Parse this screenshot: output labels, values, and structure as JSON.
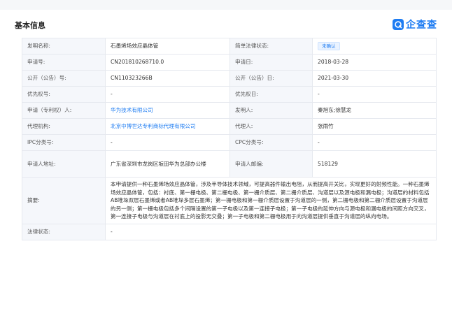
{
  "header": {
    "title": "基本信息",
    "logo_text": "企查查"
  },
  "rows": [
    {
      "l1": "发明名称:",
      "v1": "石墨烯场效应晶体管",
      "l2": "简单法律状态:",
      "v2": "未确认"
    },
    {
      "l1": "申请号:",
      "v1": "CN201810268710.0",
      "l2": "申请日:",
      "v2": "2018-03-28"
    },
    {
      "l1": "公开（公告）号:",
      "v1": "CN110323266B",
      "l2": "公开（公告）日:",
      "v2": "2021-03-30"
    },
    {
      "l1": "优先权号:",
      "v1": "-",
      "l2": "优先权日:",
      "v2": "-"
    },
    {
      "l1": "申请（专利权）人:",
      "v1": "华为技术有限公司",
      "l2": "发明人:",
      "v2": "秦旭东;徐慧龙"
    },
    {
      "l1": "代理机构:",
      "v1": "北京中博世达专利商标代理有限公司",
      "l2": "代理人:",
      "v2": "张雨竹"
    },
    {
      "l1": "IPC分类号:",
      "v1": "-",
      "l2": "CPC分类号:",
      "v2": "-"
    },
    {
      "l1": "申请人地址:",
      "v1": "广东省深圳市龙岗区坂田华为总部办公楼",
      "l2": "申请人邮编:",
      "v2": "518129"
    }
  ],
  "abstract": {
    "label": "摘要:",
    "text": "本申请提供一种石墨烯场效应晶体管，涉及半导体技术领域，可提高器件输出电阻，从而提高开关比，实现更好的射频性能。一种石墨烯场效应晶体管，包括：衬底、第一栅电极、第二栅电极、第一栅介质层、第二栅介质层、沟道层以及源电极和漏电极；沟道层的材料包括AB堆垛双层石墨烯或者AB堆垛多层石墨烯；第一栅电极和第一栅介质层设置于沟道层的一侧，第二栅电极和第二栅介质层设置于沟道层的另一侧；第一栅电极包括多个间隔设置的第一子电极以及第一连接子电极；第一子电极的延伸方向与源电极和漏电极的间距方向交叉，第一连接子电极与沟道层在衬底上的投影无交叠；第一子电极和第二栅电极用于向沟道层提供垂直于沟道层的纵向电场。"
  },
  "legal": {
    "label": "法律状态:",
    "value": "-"
  }
}
